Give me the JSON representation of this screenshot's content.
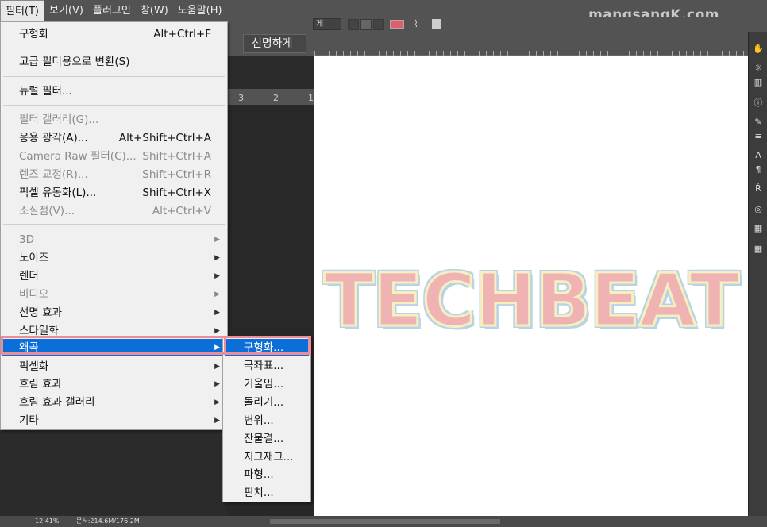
{
  "menubar": {
    "items": [
      "필터(T)",
      "보기(V)",
      "플러그인",
      "창(W)",
      "도움말(H)"
    ]
  },
  "watermark": "mangsangK.com",
  "options": {
    "dropdown_value": "게",
    "antialias_value": "선명하게"
  },
  "ruler": {
    "numbers": [
      "3",
      "2",
      "1"
    ]
  },
  "canvas": {
    "text": "TECHBEAT",
    "fill": "#f0b3b3",
    "outline": "#b9d3e6"
  },
  "status": {
    "zoom": "12.41%",
    "doc_info": "문서:214.6M/176.2M"
  },
  "filter_menu": {
    "last_filter": {
      "label": "구형화",
      "shortcut": "Alt+Ctrl+F"
    },
    "convert_smart": "고급 필터용으로 변환(S)",
    "neural": "뉴럴 필터...",
    "gallery": "필터 갤러리(G)...",
    "adaptive_wide": {
      "label": "응용 광각(A)...",
      "shortcut": "Alt+Shift+Ctrl+A"
    },
    "camera_raw": {
      "label": "Camera Raw 필터(C)...",
      "shortcut": "Shift+Ctrl+A"
    },
    "lens_correction": {
      "label": "렌즈 교정(R)...",
      "shortcut": "Shift+Ctrl+R"
    },
    "liquify": {
      "label": "픽셀 유동화(L)...",
      "shortcut": "Shift+Ctrl+X"
    },
    "vanishing_point": {
      "label": "소실점(V)...",
      "shortcut": "Alt+Ctrl+V"
    },
    "submenus": [
      {
        "label": "3D",
        "disabled": true
      },
      {
        "label": "노이즈",
        "disabled": false
      },
      {
        "label": "렌더",
        "disabled": false
      },
      {
        "label": "비디오",
        "disabled": true
      },
      {
        "label": "선명 효과",
        "disabled": false
      },
      {
        "label": "스타일화",
        "disabled": false
      },
      {
        "label": "왜곡",
        "disabled": false
      },
      {
        "label": "픽셀화",
        "disabled": false
      },
      {
        "label": "흐림 효과",
        "disabled": false
      },
      {
        "label": "흐림 효과 갤러리",
        "disabled": false
      },
      {
        "label": "기타",
        "disabled": false
      }
    ]
  },
  "distort_submenu": [
    "구형화...",
    "극좌표...",
    "기울임...",
    "돌리기...",
    "변위...",
    "잔물결...",
    "지그재그...",
    "파형...",
    "핀치..."
  ],
  "colors": {
    "menu_highlight": "#0a6fd8",
    "annotation": "#f08c98"
  }
}
